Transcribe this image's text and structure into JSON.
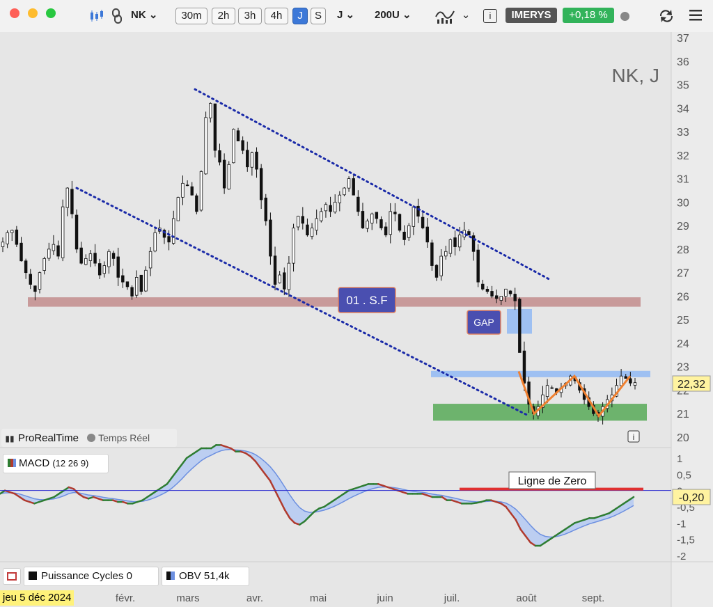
{
  "toolbar": {
    "symbol": "NK",
    "intervals": [
      "30m",
      "2h",
      "3h",
      "4h",
      "J",
      "S"
    ],
    "selected_interval": "J",
    "period": "J",
    "bars": "200U",
    "instrument": "IMERYS",
    "change": "+0,18 %"
  },
  "chart_title": "NK, J",
  "price_label": "22,32",
  "brand": "ProRealTime",
  "feed": "Temps Réel",
  "annotations": {
    "sf_label": "01 . S.F",
    "gap_label": "GAP",
    "zero_line_label": "Ligne de Zero"
  },
  "macd_legend": "MACD",
  "macd_params": "(12 26 9)",
  "macd_value_label": "-0,20",
  "bottom_indicators": [
    {
      "name": "Puissance Cycles",
      "value": "0"
    },
    {
      "name": "OBV",
      "value": "51,4k"
    }
  ],
  "date_label": "jeu 5 déc 2024",
  "colors": {
    "resistance_zone": "#c89a9a",
    "support_zone": "#6db36d",
    "blue_zone": "#9ec0f2",
    "gap_box": "#9ec0f2",
    "channel_lines": "#1a2aa8",
    "zigzag": "#f08030",
    "macd_up": "#2e7d32",
    "macd_down": "#b03a2e",
    "signal": "#6c8fe0",
    "zero_line": "#2a2ad0",
    "zero_marker": "#e03030",
    "label_box": "#4a4fb0"
  },
  "chart_data": [
    {
      "type": "candlestick",
      "title": "NK, J",
      "x_tick_labels": [
        "févr.",
        "mars",
        "avr.",
        "mai",
        "juin",
        "juil.",
        "août",
        "sept."
      ],
      "y_ticks": [
        37,
        36,
        35,
        34,
        33,
        32,
        31,
        30,
        29,
        28,
        27,
        26,
        25,
        24,
        23,
        22,
        21,
        20
      ],
      "ylim": [
        20,
        37
      ],
      "last_price": 22.32,
      "series": [
        {
          "name": "NK",
          "close": [
            28.3,
            28.7,
            28.8,
            28.2,
            27.5,
            27.0,
            26.5,
            26.2,
            27.0,
            27.6,
            28.0,
            28.2,
            27.7,
            29.8,
            30.6,
            29.5,
            28.0,
            27.4,
            27.6,
            27.8,
            27.4,
            26.9,
            27.3,
            27.9,
            27.6,
            26.8,
            26.6,
            26.4,
            26.0,
            26.8,
            26.2,
            27.1,
            27.9,
            28.7,
            28.9,
            28.5,
            28.3,
            29.3,
            30.2,
            30.8,
            30.7,
            30.3,
            29.6,
            31.3,
            33.6,
            34.2,
            32.2,
            31.7,
            30.6,
            31.6,
            33.1,
            32.6,
            32.2,
            31.5,
            32.1,
            31.4,
            30.1,
            29.2,
            27.7,
            26.5,
            26.9,
            26.3,
            27.4,
            28.9,
            29.4,
            29.1,
            28.6,
            28.9,
            29.3,
            29.6,
            29.9,
            29.6,
            30.0,
            30.3,
            30.6,
            31.0,
            30.3,
            29.6,
            28.9,
            29.2,
            29.5,
            29.3,
            28.9,
            28.6,
            29.6,
            29.5,
            28.8,
            28.4,
            29.0,
            29.8,
            29.4,
            28.9,
            28.3,
            27.3,
            26.8,
            27.7,
            27.9,
            28.4,
            28.1,
            28.6,
            28.8,
            28.6,
            27.9,
            26.6,
            26.3,
            26.2,
            26.0,
            25.9,
            26.0,
            26.3,
            26.1,
            25.8,
            23.6,
            22.3,
            21.4,
            21.0,
            21.3,
            21.8,
            22.2,
            22.1,
            21.9,
            22.1,
            22.3,
            22.6,
            22.4,
            22.0,
            21.6,
            21.3,
            21.0,
            20.9,
            21.3,
            21.6,
            21.8,
            22.2,
            22.6,
            22.5,
            22.3,
            22.32
          ]
        },
        {
          "name": "MACD",
          "values": [
            -0.1,
            0.0,
            -0.05,
            -0.1,
            -0.2,
            -0.3,
            -0.35,
            -0.4,
            -0.35,
            -0.3,
            -0.25,
            -0.2,
            -0.1,
            0.0,
            0.1,
            0.05,
            -0.1,
            -0.2,
            -0.25,
            -0.2,
            -0.25,
            -0.3,
            -0.3,
            -0.3,
            -0.35,
            -0.35,
            -0.4,
            -0.4,
            -0.35,
            -0.3,
            -0.2,
            -0.1,
            0.0,
            0.1,
            0.2,
            0.4,
            0.6,
            0.8,
            1.0,
            1.1,
            1.2,
            1.3,
            1.3,
            1.3,
            1.4,
            1.4,
            1.35,
            1.3,
            1.2,
            1.2,
            1.15,
            1.05,
            0.9,
            0.7,
            0.5,
            0.3,
            0.0,
            -0.3,
            -0.6,
            -0.85,
            -1.0,
            -1.05,
            -0.95,
            -0.8,
            -0.65,
            -0.55,
            -0.5,
            -0.4,
            -0.3,
            -0.2,
            -0.1,
            0.0,
            0.05,
            0.1,
            0.15,
            0.2,
            0.2,
            0.2,
            0.15,
            0.1,
            0.05,
            0.0,
            -0.05,
            -0.1,
            -0.1,
            -0.1,
            -0.1,
            -0.15,
            -0.2,
            -0.2,
            -0.2,
            -0.3,
            -0.3,
            -0.35,
            -0.4,
            -0.4,
            -0.4,
            -0.38,
            -0.35,
            -0.3,
            -0.3,
            -0.35,
            -0.4,
            -0.5,
            -0.7,
            -0.9,
            -1.2,
            -1.4,
            -1.6,
            -1.7,
            -1.7,
            -1.6,
            -1.5,
            -1.4,
            -1.3,
            -1.2,
            -1.1,
            -1.0,
            -0.95,
            -0.9,
            -0.85,
            -0.85,
            -0.8,
            -0.75,
            -0.7,
            -0.6,
            -0.5,
            -0.4,
            -0.3,
            -0.2
          ]
        }
      ],
      "macd_ylim": [
        -2,
        1
      ],
      "macd_y_ticks": [
        1,
        0.5,
        0,
        -0.5,
        -1,
        -1.5,
        -2
      ]
    }
  ]
}
